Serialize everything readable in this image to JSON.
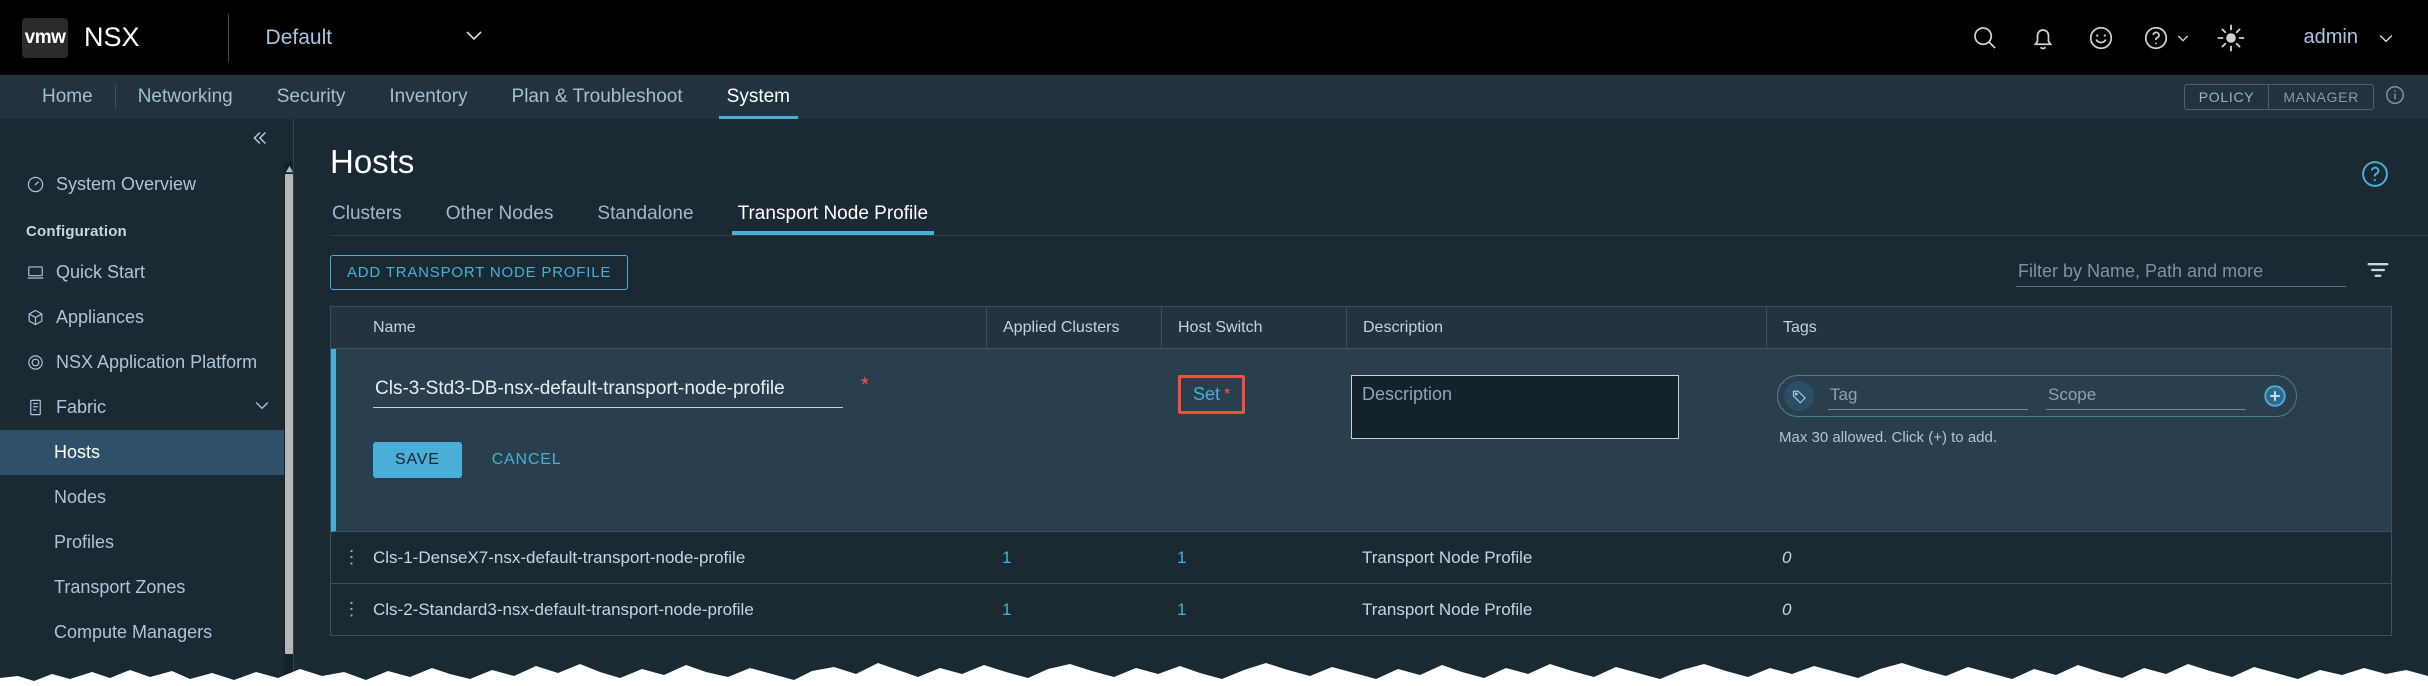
{
  "header": {
    "logo_text": "vmw",
    "product": "NSX",
    "tenant": "Default",
    "user": "admin",
    "icons": [
      "search-icon",
      "bell-icon",
      "smiley-icon",
      "help-icon",
      "theme-icon"
    ]
  },
  "nav": {
    "items": [
      {
        "label": "Home",
        "active": false
      },
      {
        "label": "Networking",
        "active": false
      },
      {
        "label": "Security",
        "active": false
      },
      {
        "label": "Inventory",
        "active": false
      },
      {
        "label": "Plan & Troubleshoot",
        "active": false
      },
      {
        "label": "System",
        "active": true
      }
    ],
    "mode_policy": "POLICY",
    "mode_manager": "MANAGER"
  },
  "sidebar": {
    "overview": "System Overview",
    "group_title": "Configuration",
    "items": [
      {
        "label": "Quick Start",
        "icon": "monitor-icon"
      },
      {
        "label": "Appliances",
        "icon": "cube-icon"
      },
      {
        "label": "NSX Application Platform",
        "icon": "gear-circle-icon"
      },
      {
        "label": "Fabric",
        "icon": "server-icon"
      }
    ],
    "fabric_children": [
      {
        "label": "Hosts",
        "selected": true
      },
      {
        "label": "Nodes",
        "selected": false
      },
      {
        "label": "Profiles",
        "selected": false
      },
      {
        "label": "Transport Zones",
        "selected": false
      },
      {
        "label": "Compute Managers",
        "selected": false
      }
    ]
  },
  "main": {
    "title": "Hosts",
    "tabs": [
      {
        "label": "Clusters",
        "active": false
      },
      {
        "label": "Other Nodes",
        "active": false
      },
      {
        "label": "Standalone",
        "active": false
      },
      {
        "label": "Transport Node Profile",
        "active": true
      }
    ],
    "add_button": "ADD TRANSPORT NODE PROFILE",
    "filter_placeholder": "Filter by Name, Path and more",
    "filter_value": ""
  },
  "table": {
    "columns": [
      "Name",
      "Applied Clusters",
      "Host Switch",
      "Description",
      "Tags"
    ],
    "edit_row": {
      "name_value": "Cls-3-Std3-DB-nsx-default-transport-node-profile",
      "name_required": "*",
      "host_switch_link": "Set",
      "host_switch_required": "*",
      "description_placeholder": "Description",
      "description_value": "",
      "tag_placeholder": "Tag",
      "tag_value": "",
      "scope_placeholder": "Scope",
      "scope_value": "",
      "tag_hint": "Max 30 allowed. Click (+) to add.",
      "save_label": "SAVE",
      "cancel_label": "CANCEL",
      "highlight_color": "#fb4c42"
    },
    "rows": [
      {
        "name": "Cls-1-DenseX7-nsx-default-transport-node-profile",
        "applied_clusters": "1",
        "host_switch": "1",
        "description": "Transport Node Profile",
        "tags": "0"
      },
      {
        "name": "Cls-2-Standard3-nsx-default-transport-node-profile",
        "applied_clusters": "1",
        "host_switch": "1",
        "description": "Transport Node Profile",
        "tags": "0"
      }
    ]
  },
  "colors": {
    "accent": "#49afd9",
    "header_bg": "#000000",
    "nav_bg": "#22333d",
    "body_bg": "#1b2a32",
    "selected_bg": "#2e5068",
    "required": "#f5564a"
  }
}
